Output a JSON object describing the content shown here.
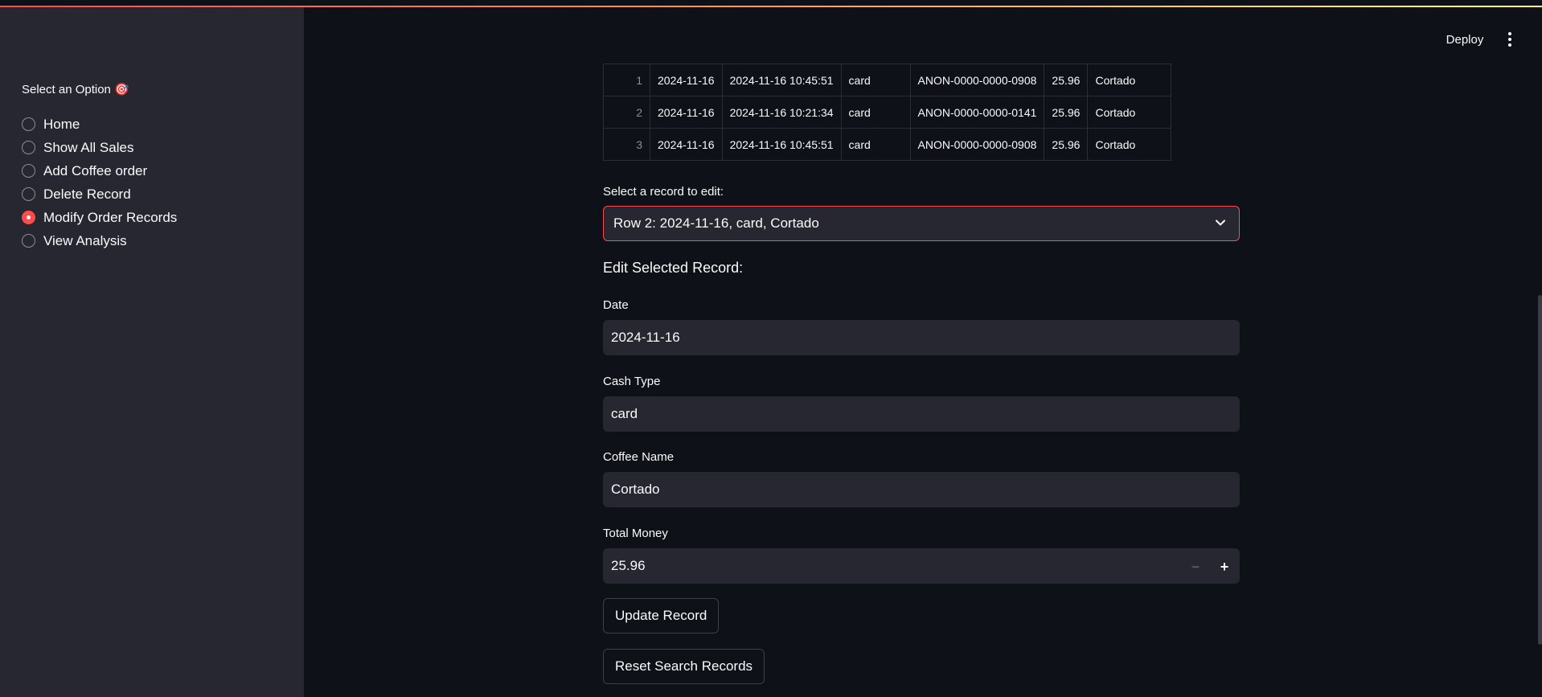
{
  "header": {
    "deploy_label": "Deploy"
  },
  "sidebar": {
    "label": "Select an Option 🎯",
    "options": [
      {
        "label": "Home",
        "selected": false
      },
      {
        "label": "Show All Sales",
        "selected": false
      },
      {
        "label": "Add Coffee order",
        "selected": false
      },
      {
        "label": "Delete Record",
        "selected": false
      },
      {
        "label": "Modify Order Records",
        "selected": true
      },
      {
        "label": "View Analysis",
        "selected": false
      }
    ]
  },
  "table": {
    "rows": [
      [
        "1",
        "2024-11-16",
        "2024-11-16 10:45:51",
        "card",
        "ANON-0000-0000-0908",
        "25.96",
        "Cortado"
      ],
      [
        "2",
        "2024-11-16",
        "2024-11-16 10:21:34",
        "card",
        "ANON-0000-0000-0141",
        "25.96",
        "Cortado"
      ],
      [
        "3",
        "2024-11-16",
        "2024-11-16 10:45:51",
        "card",
        "ANON-0000-0000-0908",
        "25.96",
        "Cortado"
      ]
    ]
  },
  "record_select": {
    "label": "Select a record to edit:",
    "value": "Row 2: 2024-11-16, card, Cortado"
  },
  "edit": {
    "title": "Edit Selected Record:",
    "date_label": "Date",
    "date_value": "2024-11-16",
    "cash_type_label": "Cash Type",
    "cash_type_value": "card",
    "coffee_name_label": "Coffee Name",
    "coffee_name_value": "Cortado",
    "total_money_label": "Total Money",
    "total_money_value": "25.96",
    "minus": "−",
    "plus": "+"
  },
  "buttons": {
    "update": "Update Record",
    "reset": "Reset Search Records"
  },
  "colors": {
    "accent": "#ff4b4b",
    "background": "#0e1117",
    "sidebar": "#262730"
  }
}
